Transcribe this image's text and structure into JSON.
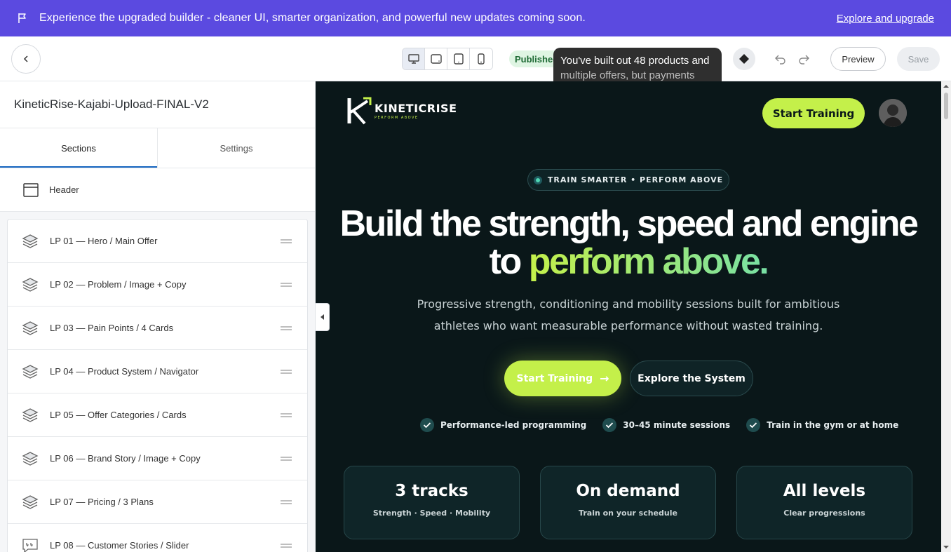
{
  "banner": {
    "message": "Experience the upgraded builder - cleaner UI, smarter organization, and powerful new updates coming soon.",
    "link": "Explore and upgrade"
  },
  "toolbar": {
    "status": "Published",
    "tooltip_line1": "You've built out 48 products and",
    "tooltip_line2": "multiple offers, but payments",
    "preview_label": "Preview",
    "save_label": "Save",
    "devices": [
      "desktop-icon",
      "tablet-landscape-icon",
      "tablet-portrait-icon",
      "mobile-icon"
    ]
  },
  "panel": {
    "site_name": "KineticRise-Kajabi-Upload-FINAL-V2",
    "tabs": [
      {
        "label": "Sections"
      },
      {
        "label": "Settings"
      }
    ],
    "header_label": "Header",
    "sections": [
      {
        "label": "LP 01 — Hero / Main Offer",
        "icon": "layers-icon"
      },
      {
        "label": "LP 02 — Problem / Image + Copy",
        "icon": "layers-icon"
      },
      {
        "label": "LP 03 — Pain Points / 4 Cards",
        "icon": "layers-icon"
      },
      {
        "label": "LP 04 — Product System / Navigator",
        "icon": "layers-icon"
      },
      {
        "label": "LP 05 — Offer Categories / Cards",
        "icon": "layers-icon"
      },
      {
        "label": "LP 06 — Brand Story / Image + Copy",
        "icon": "layers-icon"
      },
      {
        "label": "LP 07 — Pricing / 3 Plans",
        "icon": "layers-icon"
      },
      {
        "label": "LP 08 — Customer Stories / Slider",
        "icon": "quote-icon"
      }
    ]
  },
  "site": {
    "brand_name": "KINETICRISE",
    "brand_tagline": "PERFORM ABOVE",
    "nav_cta": "Start Training",
    "pill": "TRAIN SMARTER • PERFORM ABOVE",
    "headline_line1": "Build the strength, speed and engine",
    "headline_line2_prefix": "to ",
    "headline_line2_accent": "perform above.",
    "sub_line1": "Progressive strength, conditioning and mobility sessions built for ambitious",
    "sub_line2": "athletes who want measurable performance without wasted training.",
    "cta_primary": "Start Training",
    "cta_secondary": "Explore the System",
    "checks": [
      "Performance-led programming",
      "30–45 minute sessions",
      "Train in the gym or at home"
    ],
    "stats": [
      {
        "big": "3 tracks",
        "small": "Strength · Speed · Mobility"
      },
      {
        "big": "On demand",
        "small": "Train on your schedule"
      },
      {
        "big": "All levels",
        "small": "Clear progressions"
      }
    ],
    "colors": {
      "accent": "#c4f04a",
      "background": "#0a1719",
      "brand_purple": "#5b4ae0"
    }
  }
}
